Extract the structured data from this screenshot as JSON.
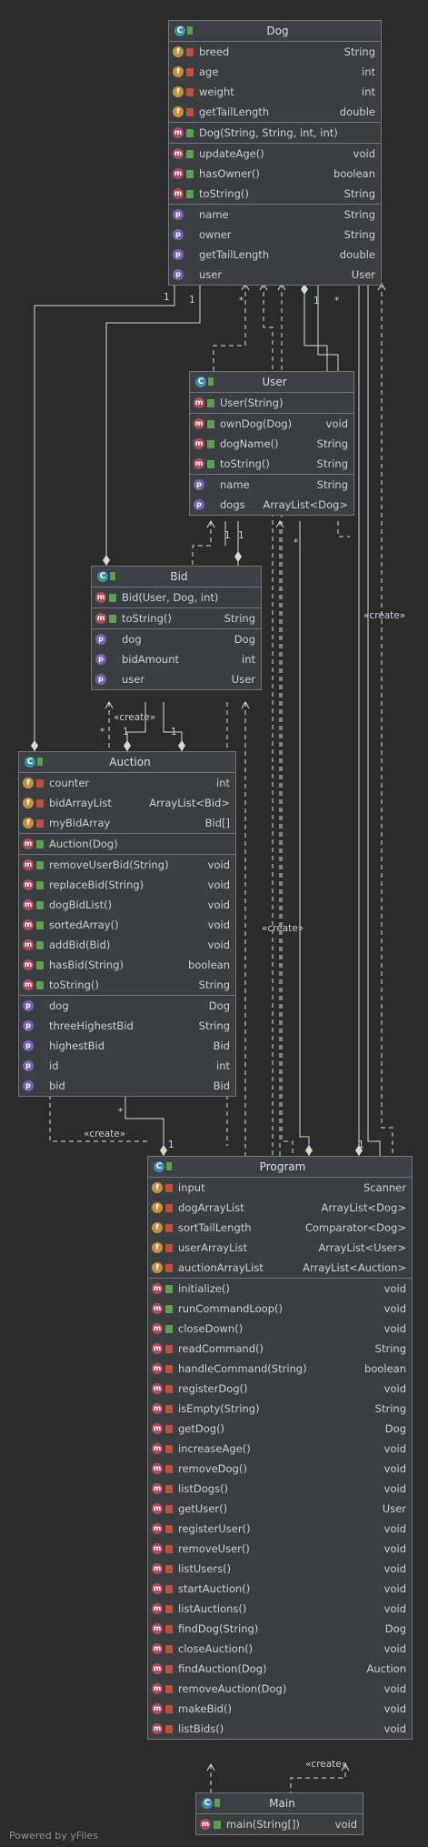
{
  "classes": {
    "dog": {
      "name": "Dog",
      "badge": "c",
      "fields": [
        {
          "kind": "f",
          "vis": "priv",
          "name": "breed",
          "type": "String"
        },
        {
          "kind": "f",
          "vis": "priv",
          "name": "age",
          "type": "int"
        },
        {
          "kind": "f",
          "vis": "priv",
          "name": "weight",
          "type": "int"
        },
        {
          "kind": "f",
          "vis": "priv",
          "name": "getTailLength",
          "type": "double"
        }
      ],
      "constructors": [
        {
          "kind": "m",
          "vis": "pub",
          "name": "Dog(String, String, int, int)",
          "type": ""
        }
      ],
      "methods": [
        {
          "kind": "m",
          "vis": "pub",
          "name": "updateAge()",
          "type": "void"
        },
        {
          "kind": "m",
          "vis": "pub",
          "name": "hasOwner()",
          "type": "boolean"
        },
        {
          "kind": "m",
          "vis": "pub",
          "name": "toString()",
          "type": "String"
        }
      ],
      "properties": [
        {
          "kind": "p",
          "vis": "none",
          "name": "name",
          "type": "String"
        },
        {
          "kind": "p",
          "vis": "none",
          "name": "owner",
          "type": "String"
        },
        {
          "kind": "p",
          "vis": "none",
          "name": "getTailLength",
          "type": "double"
        },
        {
          "kind": "p",
          "vis": "none",
          "name": "user",
          "type": "User"
        }
      ]
    },
    "user": {
      "name": "User",
      "badge": "c",
      "fields": [],
      "constructors": [
        {
          "kind": "m",
          "vis": "pub",
          "name": "User(String)",
          "type": ""
        }
      ],
      "methods": [
        {
          "kind": "m",
          "vis": "pub",
          "name": "ownDog(Dog)",
          "type": "void"
        },
        {
          "kind": "m",
          "vis": "pub",
          "name": "dogName()",
          "type": "String"
        },
        {
          "kind": "m",
          "vis": "pub",
          "name": "toString()",
          "type": "String"
        }
      ],
      "properties": [
        {
          "kind": "p",
          "vis": "none",
          "name": "name",
          "type": "String"
        },
        {
          "kind": "p",
          "vis": "none",
          "name": "dogs",
          "type": "ArrayList<Dog>"
        }
      ]
    },
    "bid": {
      "name": "Bid",
      "badge": "c",
      "fields": [],
      "constructors": [
        {
          "kind": "m",
          "vis": "pub",
          "name": "Bid(User, Dog, int)",
          "type": ""
        }
      ],
      "methods": [
        {
          "kind": "m",
          "vis": "pub",
          "name": "toString()",
          "type": "String"
        }
      ],
      "properties": [
        {
          "kind": "p",
          "vis": "none",
          "name": "dog",
          "type": "Dog"
        },
        {
          "kind": "p",
          "vis": "none",
          "name": "bidAmount",
          "type": "int"
        },
        {
          "kind": "p",
          "vis": "none",
          "name": "user",
          "type": "User"
        }
      ]
    },
    "auction": {
      "name": "Auction",
      "badge": "c",
      "fields": [
        {
          "kind": "f",
          "vis": "priv",
          "name": "counter",
          "type": "int"
        },
        {
          "kind": "f",
          "vis": "priv",
          "name": "bidArrayList",
          "type": "ArrayList<Bid>"
        },
        {
          "kind": "f",
          "vis": "priv",
          "name": "myBidArray",
          "type": "Bid[]"
        }
      ],
      "constructors": [
        {
          "kind": "m",
          "vis": "pub",
          "name": "Auction(Dog)",
          "type": ""
        }
      ],
      "methods": [
        {
          "kind": "m",
          "vis": "pub",
          "name": "removeUserBid(String)",
          "type": "void"
        },
        {
          "kind": "m",
          "vis": "pub",
          "name": "replaceBid(String)",
          "type": "void"
        },
        {
          "kind": "m",
          "vis": "pub",
          "name": "dogBidList()",
          "type": "void"
        },
        {
          "kind": "m",
          "vis": "pub",
          "name": "sortedArray()",
          "type": "void"
        },
        {
          "kind": "m",
          "vis": "pub",
          "name": "addBid(Bid)",
          "type": "void"
        },
        {
          "kind": "m",
          "vis": "pub",
          "name": "hasBid(String)",
          "type": "boolean"
        },
        {
          "kind": "m",
          "vis": "pub",
          "name": "toString()",
          "type": "String"
        }
      ],
      "properties": [
        {
          "kind": "p",
          "vis": "none",
          "name": "dog",
          "type": "Dog"
        },
        {
          "kind": "p",
          "vis": "none",
          "name": "threeHighestBid",
          "type": "String"
        },
        {
          "kind": "p",
          "vis": "none",
          "name": "highestBid",
          "type": "Bid"
        },
        {
          "kind": "p",
          "vis": "none",
          "name": "id",
          "type": "int"
        },
        {
          "kind": "p",
          "vis": "none",
          "name": "bid",
          "type": "Bid"
        }
      ]
    },
    "program": {
      "name": "Program",
      "badge": "c",
      "fields": [
        {
          "kind": "f",
          "vis": "priv",
          "name": "input",
          "type": "Scanner"
        },
        {
          "kind": "f",
          "vis": "priv",
          "name": "dogArrayList",
          "type": "ArrayList<Dog>"
        },
        {
          "kind": "f",
          "vis": "priv",
          "name": "sortTailLength",
          "type": "Comparator<Dog>"
        },
        {
          "kind": "f",
          "vis": "priv",
          "name": "userArrayList",
          "type": "ArrayList<User>"
        },
        {
          "kind": "f",
          "vis": "priv",
          "name": "auctionArrayList",
          "type": "ArrayList<Auction>"
        }
      ],
      "constructors": [],
      "methods": [
        {
          "kind": "m",
          "vis": "pub",
          "name": "initialize()",
          "type": "void"
        },
        {
          "kind": "m",
          "vis": "pub",
          "name": "runCommandLoop()",
          "type": "void"
        },
        {
          "kind": "m",
          "vis": "pub",
          "name": "closeDown()",
          "type": "void"
        },
        {
          "kind": "m",
          "vis": "priv",
          "name": "readCommand()",
          "type": "String"
        },
        {
          "kind": "m",
          "vis": "priv",
          "name": "handleCommand(String)",
          "type": "boolean"
        },
        {
          "kind": "m",
          "vis": "priv",
          "name": "registerDog()",
          "type": "void"
        },
        {
          "kind": "m",
          "vis": "priv",
          "name": "isEmpty(String)",
          "type": "String"
        },
        {
          "kind": "m",
          "vis": "priv",
          "name": "getDog()",
          "type": "Dog"
        },
        {
          "kind": "m",
          "vis": "priv",
          "name": "increaseAge()",
          "type": "void"
        },
        {
          "kind": "m",
          "vis": "priv",
          "name": "removeDog()",
          "type": "void"
        },
        {
          "kind": "m",
          "vis": "priv",
          "name": "listDogs()",
          "type": "void"
        },
        {
          "kind": "m",
          "vis": "priv",
          "name": "getUser()",
          "type": "User"
        },
        {
          "kind": "m",
          "vis": "priv",
          "name": "registerUser()",
          "type": "void"
        },
        {
          "kind": "m",
          "vis": "priv",
          "name": "removeUser()",
          "type": "void"
        },
        {
          "kind": "m",
          "vis": "priv",
          "name": "listUsers()",
          "type": "void"
        },
        {
          "kind": "m",
          "vis": "priv",
          "name": "startAuction()",
          "type": "void"
        },
        {
          "kind": "m",
          "vis": "priv",
          "name": "listAuctions()",
          "type": "void"
        },
        {
          "kind": "m",
          "vis": "priv",
          "name": "findDog(String)",
          "type": "Dog"
        },
        {
          "kind": "m",
          "vis": "priv",
          "name": "closeAuction()",
          "type": "void"
        },
        {
          "kind": "m",
          "vis": "priv",
          "name": "findAuction(Dog)",
          "type": "Auction"
        },
        {
          "kind": "m",
          "vis": "priv",
          "name": "removeAuction(Dog)",
          "type": "void"
        },
        {
          "kind": "m",
          "vis": "priv",
          "name": "makeBid()",
          "type": "void"
        },
        {
          "kind": "m",
          "vis": "priv",
          "name": "listBids()",
          "type": "void"
        }
      ],
      "properties": []
    },
    "main": {
      "name": "Main",
      "badge": "c",
      "fields": [],
      "constructors": [],
      "methods": [
        {
          "kind": "m",
          "vis": "pub",
          "name": "main(String[])",
          "type": "void"
        }
      ],
      "properties": []
    }
  },
  "labels": {
    "create": "«create»",
    "one": "1",
    "many": "*"
  },
  "footer": "Powered by yFiles"
}
